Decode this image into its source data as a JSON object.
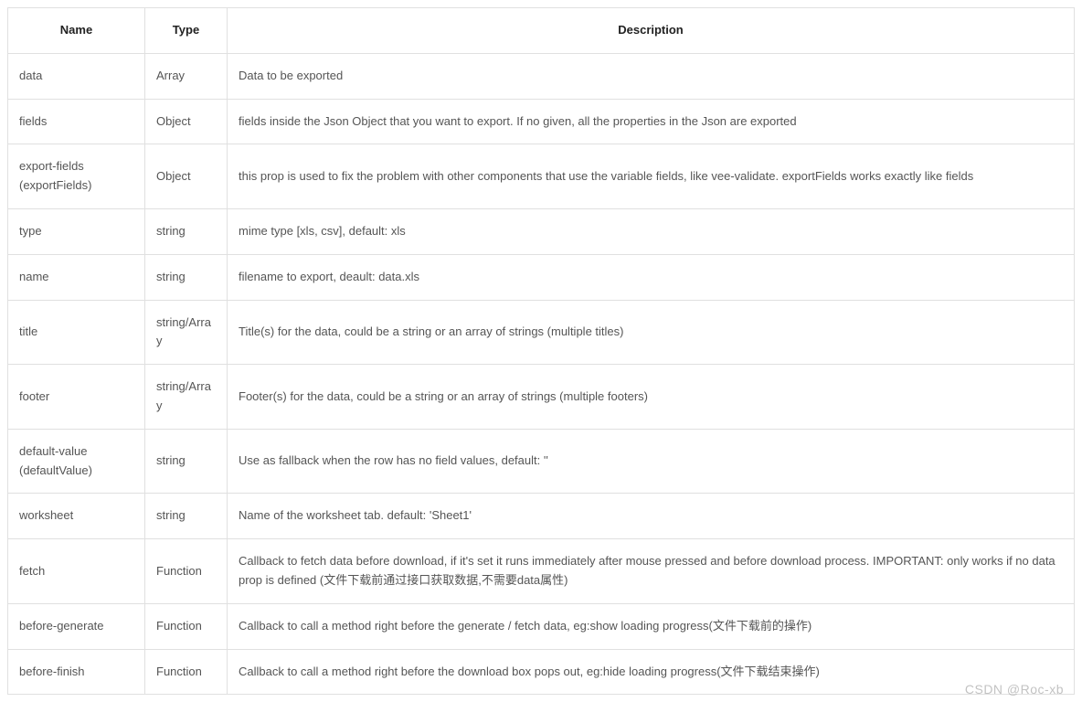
{
  "table": {
    "headers": {
      "name": "Name",
      "type": "Type",
      "description": "Description"
    },
    "rows": [
      {
        "name": "data",
        "type": "Array",
        "description": "Data to be exported"
      },
      {
        "name": "fields",
        "type": "Object",
        "description": "fields inside the Json Object that you want to export. If no given, all the properties in the Json are exported"
      },
      {
        "name": "export-fields (exportFields)",
        "type": "Object",
        "description": "this prop is used to fix the problem with other components that use the variable fields, like vee-validate. exportFields works exactly like fields"
      },
      {
        "name": "type",
        "type": "string",
        "description": "mime type [xls, csv], default: xls"
      },
      {
        "name": "name",
        "type": "string",
        "description": "filename to export, deault: data.xls"
      },
      {
        "name": "title",
        "type": "string/Array",
        "description": "Title(s) for the data, could be a string or an array of strings (multiple titles)"
      },
      {
        "name": "footer",
        "type": "string/Array",
        "description": "Footer(s) for the data, could be a string or an array of strings (multiple footers)"
      },
      {
        "name": "default-value (defaultValue)",
        "type": "string",
        "description": "Use as fallback when the row has no field values, default: ''"
      },
      {
        "name": "worksheet",
        "type": "string",
        "description": "Name of the worksheet tab. default: 'Sheet1'"
      },
      {
        "name": "fetch",
        "type": "Function",
        "description": "Callback to fetch data before download, if it's set it runs immediately after mouse pressed and before download process. IMPORTANT: only works if no data prop is defined (文件下载前通过接口获取数据,不需要data属性)"
      },
      {
        "name": "before-generate",
        "type": "Function",
        "description": "Callback to call a method right before the generate / fetch data, eg:show loading progress(文件下载前的操作)"
      },
      {
        "name": "before-finish",
        "type": "Function",
        "description": "Callback to call a method right before the download box pops out, eg:hide loading progress(文件下载结束操作)"
      }
    ]
  },
  "watermark": "CSDN @Roc-xb"
}
